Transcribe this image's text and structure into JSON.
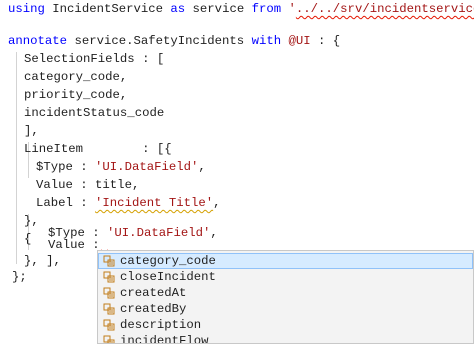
{
  "editor": {
    "lines": {
      "l1": {
        "kw_using": "using",
        "name": "IncidentService",
        "kw_as": "as",
        "alias": "service",
        "kw_from": "from",
        "q1": "'",
        "path": "../../srv/incidentservice",
        "q2": "'",
        "end": ";"
      },
      "l3": {
        "kw_annotate": "annotate",
        "target": "service.SafetyIncidents",
        "kw_with": "with",
        "anno": "@UI",
        "rest": " : {"
      },
      "l4": {
        "text": "SelectionFields : ["
      },
      "l5": {
        "text": "category_code,"
      },
      "l6": {
        "text": "priority_code,"
      },
      "l7": {
        "text": "incidentStatus_code"
      },
      "l8": {
        "text": "],"
      },
      "l9": {
        "text": "LineItem        : [{"
      },
      "l10": {
        "prop": "$Type",
        "sep": " : ",
        "value": "'UI.DataField'",
        "end": ","
      },
      "l11": {
        "prop": "Value",
        "sep": " : ",
        "value": "title",
        "end": ","
      },
      "l12": {
        "prop": "Label",
        "sep": " : ",
        "value": "'Incident Title'",
        "end": ","
      },
      "l13": {
        "text": "},"
      },
      "l14": {
        "text": "{"
      },
      "l15": {
        "prop": "$Type",
        "sep": " : ",
        "value": "'UI.DataField'",
        "end": ","
      },
      "l16": {
        "prop": "Value",
        "sep": " :"
      },
      "l17": {
        "text": "}, ],"
      },
      "l18": {
        "text": "};"
      }
    }
  },
  "suggest": {
    "icon": "enum-member-icon",
    "items": [
      {
        "label": "category_code"
      },
      {
        "label": "closeIncident"
      },
      {
        "label": "createdAt"
      },
      {
        "label": "createdBy"
      },
      {
        "label": "description"
      },
      {
        "label": "incidentFlow"
      }
    ],
    "selected_index": 0
  },
  "colors": {
    "keyword": "#0000ff",
    "string": "#a31515",
    "error_squiggle": "#e51400",
    "selection": "#d6ebff"
  }
}
